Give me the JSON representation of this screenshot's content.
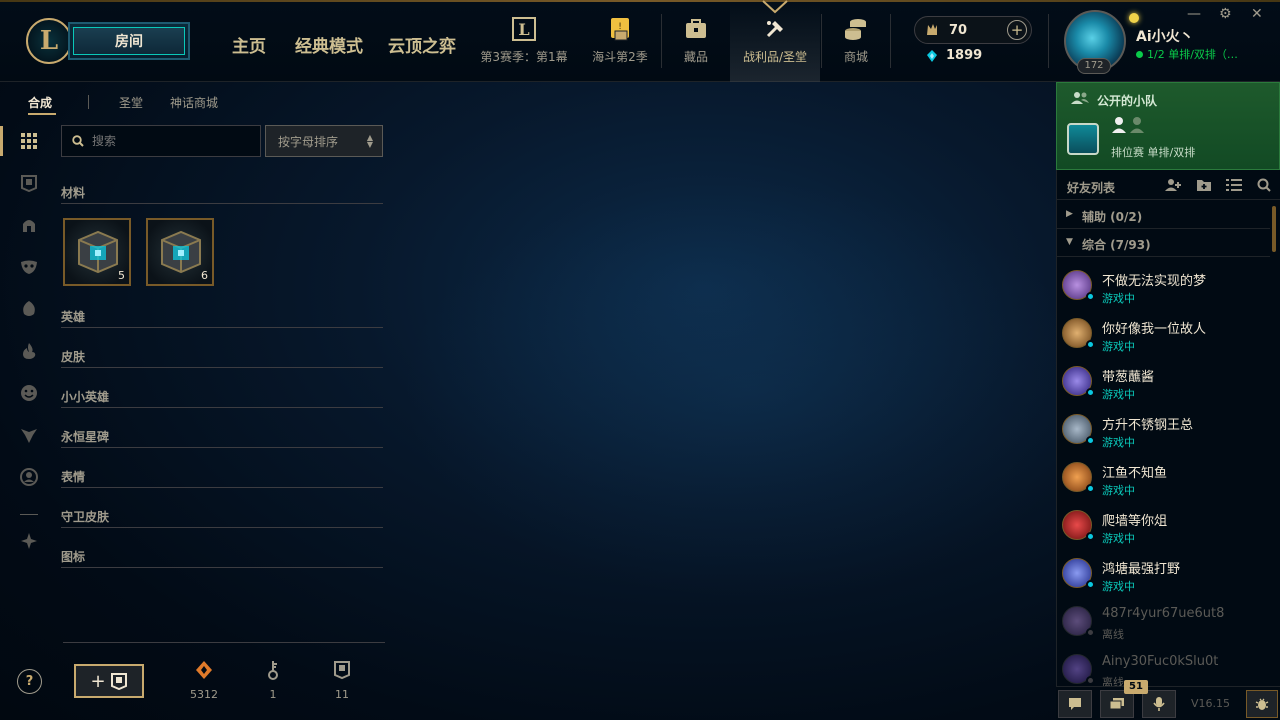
{
  "header": {
    "logo_letter": "L",
    "play_button": "房间",
    "nav_main": [
      "主页",
      "经典模式",
      "云顶之弈"
    ],
    "nav_icons": [
      {
        "label": "第3赛季：第1幕",
        "icon": "league-pass-icon"
      },
      {
        "label": "海斗第2季",
        "icon": "event-pass-icon"
      },
      {
        "label": "藏品",
        "icon": "collection-icon"
      },
      {
        "label": "战利品/圣堂",
        "icon": "loot-icon",
        "active": true
      },
      {
        "label": "商城",
        "icon": "store-icon"
      }
    ],
    "rp": "70",
    "be": "1899",
    "summoner": {
      "name": "Ai小火丶",
      "level": "172",
      "status": "1/2 单排/双排（…"
    },
    "window_controls": [
      "minimize",
      "settings",
      "close"
    ]
  },
  "loot": {
    "subnav": [
      "合成",
      "圣堂",
      "神话商城"
    ],
    "search_placeholder": "搜索",
    "sort_label": "按字母排序",
    "categories": [
      "材料",
      "英雄",
      "皮肤",
      "小小英雄",
      "永恒星碑",
      "表情",
      "守卫皮肤",
      "图标"
    ],
    "items": [
      {
        "count": "5",
        "icon": "hextech-chest-icon"
      },
      {
        "count": "6",
        "icon": "hextech-chest-icon"
      }
    ],
    "resources": [
      {
        "value": "5312",
        "icon": "orange-essence-icon"
      },
      {
        "value": "1",
        "icon": "key-icon"
      },
      {
        "value": "11",
        "icon": "chest-icon"
      }
    ],
    "help": "?",
    "craft_plus": "+"
  },
  "social": {
    "party_title": "公开的小队",
    "queue_name": "排位赛 单排/双排",
    "friends_title": "好友列表",
    "groups": [
      {
        "label": "辅助 (0/2)",
        "expanded": false
      },
      {
        "label": "综合 (7/93)",
        "expanded": true
      }
    ],
    "friends": [
      {
        "name": "不做无法实现的梦",
        "status": "游戏中",
        "online": true,
        "color": "#7a5aa8"
      },
      {
        "name": "你好像我一位故人",
        "status": "游戏中",
        "online": true,
        "color": "#a87a3a"
      },
      {
        "name": "带葱蘸酱",
        "status": "游戏中",
        "online": true,
        "color": "#5a4ab8"
      },
      {
        "name": "方升不锈钢王总",
        "status": "游戏中",
        "online": true,
        "color": "#6a7a8a"
      },
      {
        "name": "江鱼不知鱼",
        "status": "游戏中",
        "online": true,
        "color": "#c86a2a"
      },
      {
        "name": "爬墙等你俎",
        "status": "游戏中",
        "online": true,
        "color": "#b82a2a"
      },
      {
        "name": "鸿塘最强打野",
        "status": "游戏中",
        "online": true,
        "color": "#4a5ac8"
      },
      {
        "name": "487r4yur67ue6ut8",
        "status": "离线",
        "online": false,
        "color": "#6a4a8a"
      },
      {
        "name": "Ainy30Fuc0kSlu0t",
        "status": "离线",
        "online": false,
        "color": "#5a3a8a"
      }
    ],
    "message_badge": "51",
    "version": "V16.15"
  }
}
